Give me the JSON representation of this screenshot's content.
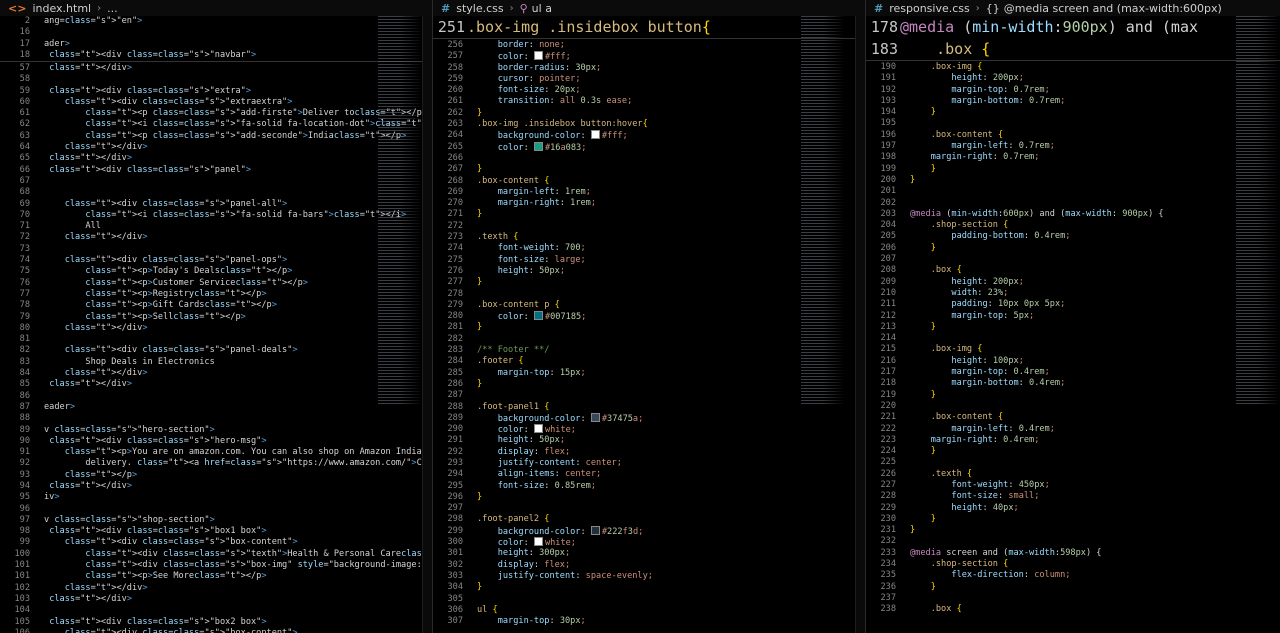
{
  "panes": {
    "html": {
      "tab": "index.html",
      "crumb_tail": "...",
      "sticky": [
        {
          "n": "2",
          "code": "ang=\"en\">"
        },
        {
          "n": "16",
          "code": ""
        },
        {
          "n": "17",
          "code": "ader>"
        },
        {
          "n": "18",
          "code": " <div class=\"navbar\">"
        }
      ],
      "lines": [
        {
          "n": "57",
          "code": " </div>"
        },
        {
          "n": "58",
          "code": ""
        },
        {
          "n": "59",
          "code": " <div class=\"extra\">"
        },
        {
          "n": "60",
          "code": "    <div class=\"extraextra\">"
        },
        {
          "n": "61",
          "code": "        <p class=\"add-firste\">Deliver to</p>"
        },
        {
          "n": "62",
          "code": "        <i class=\"fa-solid fa-location-dot\"></i>"
        },
        {
          "n": "63",
          "code": "        <p class=\"add-seconde\">India</p>"
        },
        {
          "n": "64",
          "code": "    </div>"
        },
        {
          "n": "65",
          "code": " </div>"
        },
        {
          "n": "66",
          "code": " <div class=\"panel\">"
        },
        {
          "n": "67",
          "code": ""
        },
        {
          "n": "68",
          "code": ""
        },
        {
          "n": "69",
          "code": "    <div class=\"panel-all\">"
        },
        {
          "n": "70",
          "code": "        <i class=\"fa-solid fa-bars\"></i>"
        },
        {
          "n": "71",
          "code": "        All"
        },
        {
          "n": "72",
          "code": "    </div>"
        },
        {
          "n": "73",
          "code": ""
        },
        {
          "n": "74",
          "code": "    <div class=\"panel-ops\">"
        },
        {
          "n": "75",
          "code": "        <p>Today's Deals</p>"
        },
        {
          "n": "76",
          "code": "        <p>Customer Service</p>"
        },
        {
          "n": "77",
          "code": "        <p>Registry</p>"
        },
        {
          "n": "78",
          "code": "        <p>Gift Cards</p>"
        },
        {
          "n": "79",
          "code": "        <p>Sell</p>"
        },
        {
          "n": "80",
          "code": "    </div>"
        },
        {
          "n": "81",
          "code": ""
        },
        {
          "n": "82",
          "code": "    <div class=\"panel-deals\">"
        },
        {
          "n": "83",
          "code": "        Shop Deals in Electronics"
        },
        {
          "n": "84",
          "code": "    </div>"
        },
        {
          "n": "85",
          "code": " </div>"
        },
        {
          "n": "86",
          "code": ""
        },
        {
          "n": "87",
          "code": "eader>"
        },
        {
          "n": "88",
          "code": ""
        },
        {
          "n": "89",
          "code": "v class=\"hero-section\">"
        },
        {
          "n": "90",
          "code": " <div class=\"hero-msg\">"
        },
        {
          "n": "91",
          "code": "    <p>You are on amazon.com. You can also shop on Amazon India fo"
        },
        {
          "n": "92",
          "code": "        delivery. <a href=\"https://www.amazon.com/\">Click here to"
        },
        {
          "n": "93",
          "code": "    </p>"
        },
        {
          "n": "94",
          "code": " </div>"
        },
        {
          "n": "95",
          "code": "iv>"
        },
        {
          "n": "96",
          "code": ""
        },
        {
          "n": "97",
          "code": "v class=\"shop-section\">"
        },
        {
          "n": "98",
          "code": " <div class=\"box1 box\">"
        },
        {
          "n": "99",
          "code": "    <div class=\"box-content\">"
        },
        {
          "n": "100",
          "code": "        <div class=\"texth\">Health & Personal Care</div>"
        },
        {
          "n": "101",
          "code": "        <div class=\"box-img\" style=\"background-image: url('box1.jp"
        },
        {
          "n": "101",
          "code": "        <p>See More</p>"
        },
        {
          "n": "102",
          "code": "    </div>"
        },
        {
          "n": "103",
          "code": " </div>"
        },
        {
          "n": "104",
          "code": ""
        },
        {
          "n": "105",
          "code": " <div class=\"box2 box\">"
        },
        {
          "n": "106",
          "code": "    <div class=\"box-content\">"
        }
      ]
    },
    "style": {
      "tab": "style.css",
      "crumb_tail": "ul a",
      "sticky": [
        {
          "n": "251",
          "code": ".box-img .insidebox button{"
        }
      ],
      "lines": [
        {
          "n": "256",
          "code": "    border: none;"
        },
        {
          "n": "257",
          "code": "    color: #fff;",
          "sw": "#ffffff"
        },
        {
          "n": "258",
          "code": "    border-radius: 30px;"
        },
        {
          "n": "259",
          "code": "    cursor: pointer;"
        },
        {
          "n": "260",
          "code": "    font-size: 20px;"
        },
        {
          "n": "261",
          "code": "    transition: all 0.3s ease;"
        },
        {
          "n": "262",
          "code": "}"
        },
        {
          "n": "263",
          "code": ".box-img .insidebox button:hover{"
        },
        {
          "n": "264",
          "code": "    background-color: #fff;",
          "sw": "#ffffff"
        },
        {
          "n": "265",
          "code": "    color: #16a083;",
          "sw": "#16a083"
        },
        {
          "n": "266",
          "code": ""
        },
        {
          "n": "267",
          "code": "}"
        },
        {
          "n": "268",
          "code": ".box-content {"
        },
        {
          "n": "269",
          "code": "    margin-left: 1rem;"
        },
        {
          "n": "270",
          "code": "    margin-right: 1rem;"
        },
        {
          "n": "271",
          "code": "}"
        },
        {
          "n": "272",
          "code": ""
        },
        {
          "n": "273",
          "code": ".texth {"
        },
        {
          "n": "274",
          "code": "    font-weight: 700;"
        },
        {
          "n": "275",
          "code": "    font-size: large;"
        },
        {
          "n": "276",
          "code": "    height: 50px;"
        },
        {
          "n": "277",
          "code": "}"
        },
        {
          "n": "278",
          "code": ""
        },
        {
          "n": "279",
          "code": ".box-content p {"
        },
        {
          "n": "280",
          "code": "    color: #007185;",
          "sw": "#007185"
        },
        {
          "n": "281",
          "code": "}"
        },
        {
          "n": "282",
          "code": ""
        },
        {
          "n": "283",
          "code": "/** Footer **/"
        },
        {
          "n": "284",
          "code": ".footer {"
        },
        {
          "n": "285",
          "code": "    margin-top: 15px;"
        },
        {
          "n": "286",
          "code": "}"
        },
        {
          "n": "287",
          "code": ""
        },
        {
          "n": "288",
          "code": ".foot-panel1 {"
        },
        {
          "n": "289",
          "code": "    background-color: #37475a;",
          "sw": "#37475a"
        },
        {
          "n": "290",
          "code": "    color: white;",
          "sw": "#ffffff"
        },
        {
          "n": "291",
          "code": "    height: 50px;"
        },
        {
          "n": "292",
          "code": "    display: flex;"
        },
        {
          "n": "293",
          "code": "    justify-content: center;"
        },
        {
          "n": "294",
          "code": "    align-items: center;"
        },
        {
          "n": "295",
          "code": "    font-size: 0.85rem;"
        },
        {
          "n": "296",
          "code": "}"
        },
        {
          "n": "297",
          "code": ""
        },
        {
          "n": "298",
          "code": ".foot-panel2 {"
        },
        {
          "n": "299",
          "code": "    background-color: #222f3d;",
          "sw": "#222f3d"
        },
        {
          "n": "300",
          "code": "    color: white;",
          "sw": "#ffffff"
        },
        {
          "n": "301",
          "code": "    height: 300px;"
        },
        {
          "n": "302",
          "code": "    display: flex;"
        },
        {
          "n": "303",
          "code": "    justify-content: space-evenly;"
        },
        {
          "n": "304",
          "code": "}"
        },
        {
          "n": "305",
          "code": ""
        },
        {
          "n": "306",
          "code": "ul {"
        },
        {
          "n": "307",
          "code": "    margin-top: 30px;"
        }
      ]
    },
    "resp": {
      "tab": "responsive.css",
      "crumb_tail": "@media screen and (max-width:600px)",
      "sticky": [
        {
          "n": "178",
          "code": "@media (min-width:900px) and (max"
        },
        {
          "n": "183",
          "code": "    .box {"
        }
      ],
      "lines": [
        {
          "n": "190",
          "code": "    .box-img {"
        },
        {
          "n": "191",
          "code": "        height: 200px;"
        },
        {
          "n": "192",
          "code": "        margin-top: 0.7rem;"
        },
        {
          "n": "193",
          "code": "        margin-bottom: 0.7rem;"
        },
        {
          "n": "194",
          "code": "    }"
        },
        {
          "n": "195",
          "code": ""
        },
        {
          "n": "196",
          "code": "    .box-content {"
        },
        {
          "n": "197",
          "code": "        margin-left: 0.7rem;"
        },
        {
          "n": "198",
          "code": "    margin-right: 0.7rem;"
        },
        {
          "n": "199",
          "code": "    }"
        },
        {
          "n": "200",
          "code": "}"
        },
        {
          "n": "201",
          "code": ""
        },
        {
          "n": "202",
          "code": ""
        },
        {
          "n": "203",
          "code": "@media (min-width:600px) and (max-width: 900px) {"
        },
        {
          "n": "204",
          "code": "    .shop-section {"
        },
        {
          "n": "205",
          "code": "        padding-bottom: 0.4rem;"
        },
        {
          "n": "206",
          "code": "    }"
        },
        {
          "n": "207",
          "code": ""
        },
        {
          "n": "208",
          "code": "    .box {"
        },
        {
          "n": "209",
          "code": "        height: 200px;"
        },
        {
          "n": "210",
          "code": "        width: 23%;"
        },
        {
          "n": "211",
          "code": "        padding: 10px 0px 5px;"
        },
        {
          "n": "212",
          "code": "        margin-top: 5px;"
        },
        {
          "n": "213",
          "code": "    }"
        },
        {
          "n": "214",
          "code": ""
        },
        {
          "n": "215",
          "code": "    .box-img {"
        },
        {
          "n": "216",
          "code": "        height: 100px;"
        },
        {
          "n": "217",
          "code": "        margin-top: 0.4rem;"
        },
        {
          "n": "218",
          "code": "        margin-bottom: 0.4rem;"
        },
        {
          "n": "219",
          "code": "    }"
        },
        {
          "n": "220",
          "code": ""
        },
        {
          "n": "221",
          "code": "    .box-content {"
        },
        {
          "n": "222",
          "code": "        margin-left: 0.4rem;"
        },
        {
          "n": "223",
          "code": "    margin-right: 0.4rem;"
        },
        {
          "n": "224",
          "code": "    }"
        },
        {
          "n": "225",
          "code": ""
        },
        {
          "n": "226",
          "code": "    .texth {"
        },
        {
          "n": "227",
          "code": "        font-weight: 450px;"
        },
        {
          "n": "228",
          "code": "        font-size: small;"
        },
        {
          "n": "229",
          "code": "        height: 40px;"
        },
        {
          "n": "230",
          "code": "    }"
        },
        {
          "n": "231",
          "code": "}"
        },
        {
          "n": "232",
          "code": ""
        },
        {
          "n": "233",
          "code": "@media screen and (max-width:598px) {"
        },
        {
          "n": "234",
          "code": "    .shop-section {"
        },
        {
          "n": "235",
          "code": "        flex-direction: column;"
        },
        {
          "n": "236",
          "code": "    }"
        },
        {
          "n": "237",
          "code": ""
        },
        {
          "n": "238",
          "code": "    .box {"
        }
      ]
    }
  },
  "icons": {
    "html": "code-brackets-icon",
    "css": "hash-icon",
    "symbol": "symbol-icon",
    "braces": "braces-icon"
  },
  "colors": {
    "bg": "#000000",
    "html_icon": "#e37933",
    "css_icon": "#519aba"
  }
}
